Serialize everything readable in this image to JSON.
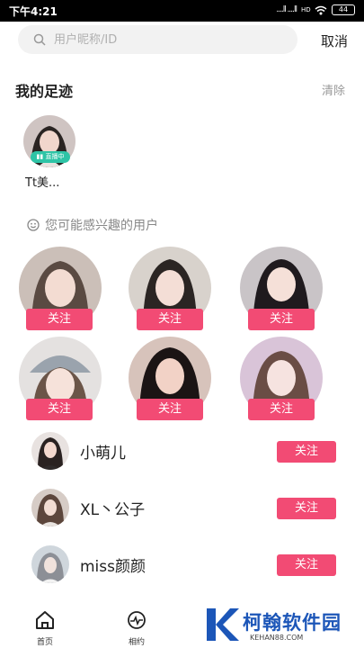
{
  "status_bar": {
    "time": "下午4:21",
    "signal": "....ll ....ll",
    "network": "HD",
    "battery": "44"
  },
  "search": {
    "placeholder": "用户昵称/ID",
    "value": "",
    "cancel_label": "取消"
  },
  "footprints": {
    "title": "我的足迹",
    "clear_label": "清除",
    "items": [
      {
        "name": "Tt美...",
        "badge": "直播中"
      }
    ]
  },
  "suggested": {
    "title": "您可能感兴趣的用户",
    "follow_label": "关注",
    "users": [
      {
        "avatar": "avatar-photo"
      },
      {
        "avatar": "avatar-photo"
      },
      {
        "avatar": "avatar-photo"
      },
      {
        "avatar": "avatar-photo"
      },
      {
        "avatar": "avatar-photo"
      },
      {
        "avatar": "avatar-photo"
      }
    ]
  },
  "user_list": {
    "follow_label": "关注",
    "items": [
      {
        "name": "小萌儿"
      },
      {
        "name": "XL丶公子"
      },
      {
        "name": "miss颜颜"
      }
    ]
  },
  "tabbar": {
    "tabs": [
      {
        "label": "首页",
        "icon": "home-icon"
      },
      {
        "label": "相约",
        "icon": "pulse-icon"
      }
    ]
  },
  "watermark": {
    "cn": "柯翰软件园",
    "en": "KEHAN88.COM"
  },
  "colors": {
    "accent": "#f24b74",
    "live": "#2ec4a6",
    "brand": "#1c56b8"
  }
}
